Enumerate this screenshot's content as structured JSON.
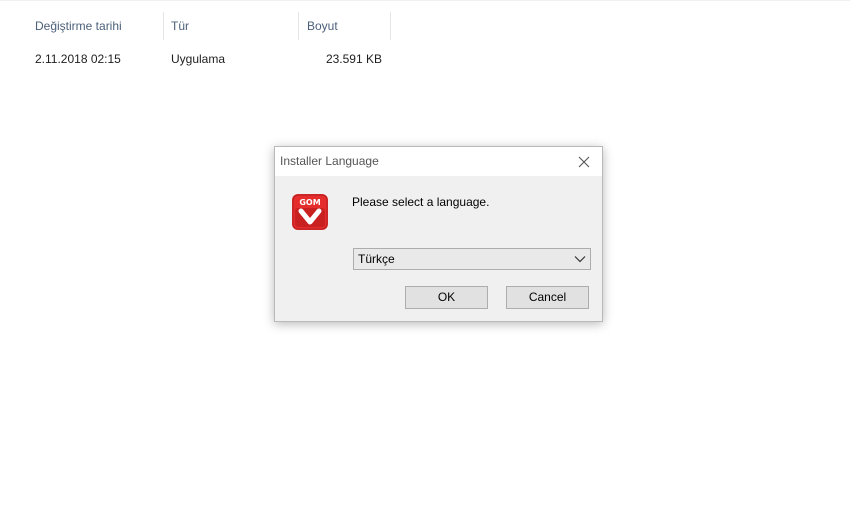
{
  "explorer": {
    "columns": [
      {
        "label": "Değiştirme tarihi"
      },
      {
        "label": "Tür"
      },
      {
        "label": "Boyut"
      }
    ],
    "row": {
      "modified": "2.11.2018 02:15",
      "type": "Uygulama",
      "size": "23.591 KB"
    }
  },
  "dialog": {
    "title": "Installer Language",
    "app_icon": {
      "name": "gom-icon",
      "text": "GOM"
    },
    "prompt": "Please select a language.",
    "language_select": {
      "value": "Türkçe"
    },
    "ok_label": "OK",
    "cancel_label": "Cancel"
  },
  "colors": {
    "column_header": "#4c607a",
    "dialog_bg": "#f0f0f0",
    "icon_red": "#e52d2d"
  }
}
